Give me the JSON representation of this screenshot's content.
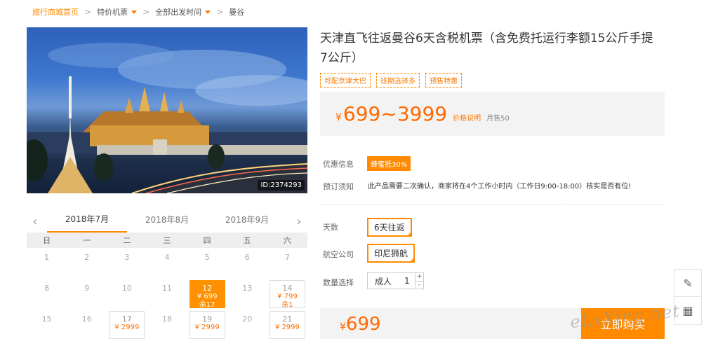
{
  "breadcrumb": {
    "home": "旅行商城首页",
    "items": [
      "特价机票",
      "全部出发时间",
      "曼谷"
    ]
  },
  "hero": {
    "image_id": "ID:2374293"
  },
  "calendar": {
    "months": [
      "2018年7月",
      "2018年8月",
      "2018年9月"
    ],
    "weekdays": [
      "日",
      "一",
      "二",
      "三",
      "四",
      "五",
      "六"
    ],
    "days": [
      {
        "num": "1"
      },
      {
        "num": "2"
      },
      {
        "num": "3"
      },
      {
        "num": "4"
      },
      {
        "num": "5"
      },
      {
        "num": "6"
      },
      {
        "num": "7"
      },
      {
        "num": "8"
      },
      {
        "num": "9"
      },
      {
        "num": "10"
      },
      {
        "num": "11"
      },
      {
        "num": "12",
        "price": "¥ 699",
        "left": "余17",
        "selected": true
      },
      {
        "num": "13"
      },
      {
        "num": "14",
        "price": "¥ 799",
        "left": "余1"
      },
      {
        "num": "15"
      },
      {
        "num": "16"
      },
      {
        "num": "17",
        "price": "¥ 2999"
      },
      {
        "num": "18"
      },
      {
        "num": "19",
        "price": "¥ 2999"
      },
      {
        "num": "20"
      },
      {
        "num": "21",
        "price": "¥ 2999"
      }
    ]
  },
  "product": {
    "title": "天津直飞往返曼谷6天含税机票（含免费托运行李额15公斤手提7公斤）",
    "tags": [
      "可配京津大巴",
      "班期选择多",
      "预售特惠"
    ],
    "price_yen": "¥",
    "price_range": "699~3999",
    "price_explain": "价格说明",
    "monthly_sales": "月售50"
  },
  "details": {
    "promo_label": "优惠信息",
    "promo_value": "蜂蜜抵30%",
    "notice_label": "预订须知",
    "notice_value": "此产品需要二次确认，商家将在4个工作小时内（工作日9:00-18:00）核实是否有位!",
    "days_label": "天数",
    "days_value": "6天往返",
    "airline_label": "航空公司",
    "airline_value": "印尼狮航",
    "qty_label": "数量选择",
    "qty_type": "成人",
    "qty_value": "1",
    "qty_plus": "+",
    "qty_minus": "-"
  },
  "buy": {
    "total_yen": "¥",
    "total": "699",
    "button": "立即购买"
  },
  "watermark": "eLxXing.net",
  "colors": {
    "accent": "#ff8a00",
    "price": "#ff6a00"
  }
}
